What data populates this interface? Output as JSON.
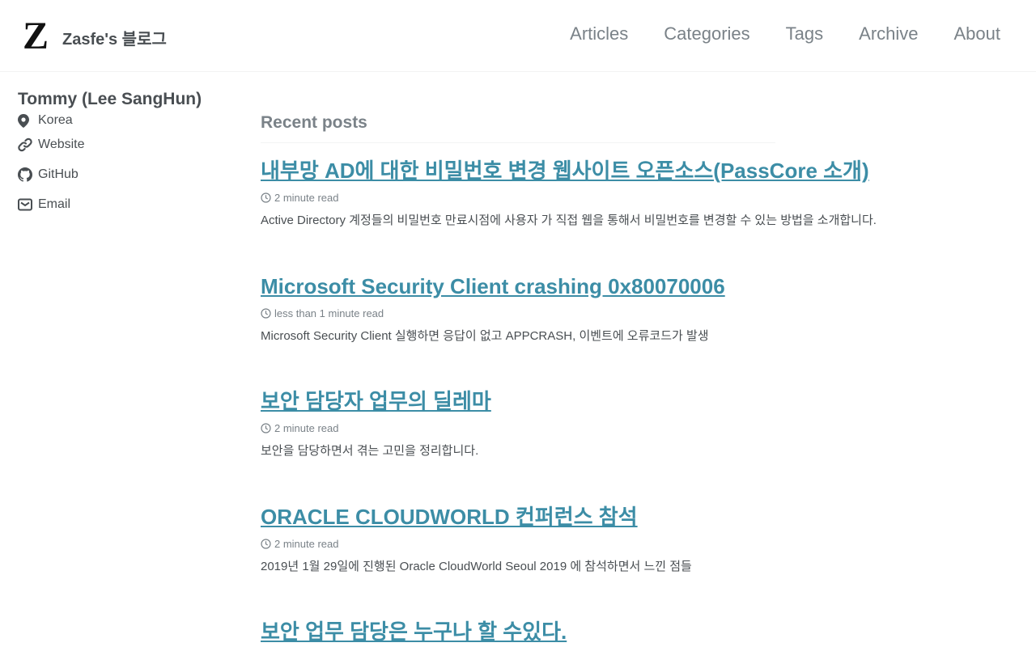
{
  "site": {
    "logo_letter": "Z",
    "title": "Zasfe's 블로그"
  },
  "nav": {
    "items": [
      {
        "label": "Articles"
      },
      {
        "label": "Categories"
      },
      {
        "label": "Tags"
      },
      {
        "label": "Archive"
      },
      {
        "label": "About"
      }
    ]
  },
  "author": {
    "name": "Tommy (Lee SangHun)",
    "location": "Korea",
    "website": "Website",
    "github": "GitHub",
    "email": "Email"
  },
  "recent": {
    "heading": "Recent posts",
    "posts": [
      {
        "title": "내부망 AD에 대한 비밀번호 변경 웹사이트 오픈소스(PassCore 소개)",
        "read_time": "2 minute read",
        "excerpt": "Active Directory 계정들의 비밀번호 만료시점에 사용자 가 직접 웹을 통해서 비밀번호를 변경할 수 있는 방법을 소개합니다."
      },
      {
        "title": "Microsoft Security Client crashing 0x80070006",
        "read_time": "less than 1 minute read",
        "excerpt": "Microsoft Security Client 실행하면 응답이 없고 APPCRASH, 이벤트에 오류코드가 발생"
      },
      {
        "title": "보안 담당자 업무의 딜레마",
        "read_time": "2 minute read",
        "excerpt": "보안을 담당하면서 겪는 고민을 정리합니다."
      },
      {
        "title": "ORACLE CLOUDWORLD 컨퍼런스 참석",
        "read_time": "2 minute read",
        "excerpt": "2019년 1월 29일에 진행된 Oracle CloudWorld Seoul 2019 에 참석하면서 느낀 점들"
      },
      {
        "title": "보안 업무 담당은 누구나 할 수있다."
      }
    ]
  },
  "colors": {
    "link": "#3c8da6",
    "text": "#494e52",
    "muted": "#7a8288"
  }
}
